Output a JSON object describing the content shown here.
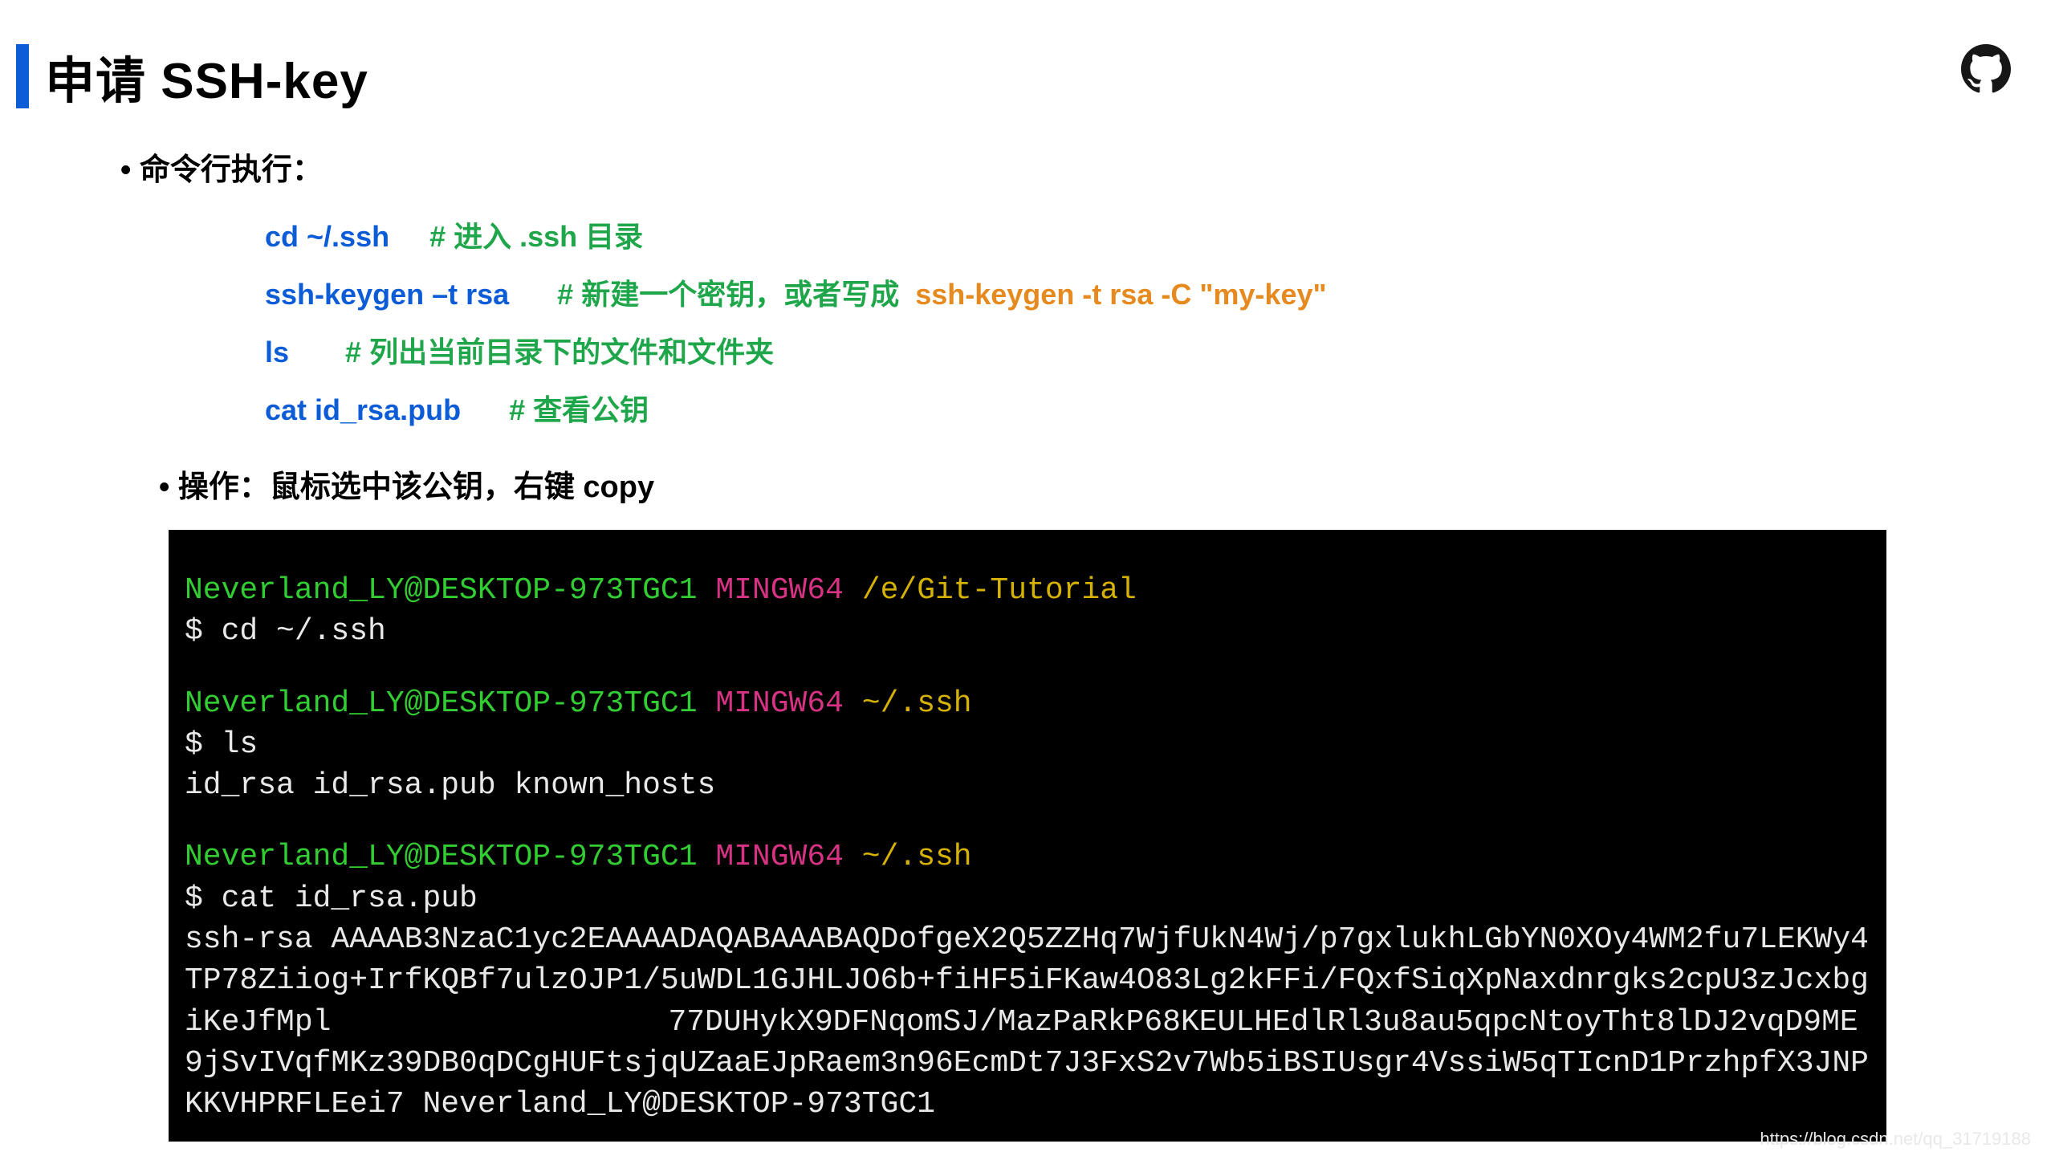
{
  "title": "申请 SSH-key",
  "bullets": {
    "exec": "• 命令行执行：",
    "op": "• 操作：鼠标选中该公钥，右键 copy"
  },
  "cmds": {
    "l1": {
      "cmd": "cd ~/.ssh",
      "cmt": "# 进入 .ssh 目录"
    },
    "l2": {
      "cmd": "ssh-keygen –t rsa",
      "cmt": "# 新建一个密钥，或者写成",
      "alt": "ssh-keygen -t rsa -C \"my-key\""
    },
    "l3": {
      "cmd": "ls",
      "cmt": "# 列出当前目录下的文件和文件夹"
    },
    "l4": {
      "cmd": "cat id_rsa.pub",
      "cmt": "# 查看公钥"
    }
  },
  "term": {
    "p1": {
      "user": "Neverland_LY@DESKTOP-973TGC1",
      "env": "MINGW64",
      "path": "/e/Git-Tutorial"
    },
    "c1": "$ cd ~/.ssh",
    "p2": {
      "user": "Neverland_LY@DESKTOP-973TGC1",
      "env": "MINGW64",
      "path": "~/.ssh"
    },
    "c2": "$ ls",
    "r2": "id_rsa  id_rsa.pub  known_hosts",
    "p3": {
      "user": "Neverland_LY@DESKTOP-973TGC1",
      "env": "MINGW64",
      "path": "~/.ssh"
    },
    "c3": "$ cat id_rsa.pub",
    "key_a": "ssh-rsa AAAAB3NzaC1yc2EAAAADAQABAAABAQDofgeX2Q5ZZHq7WjfUkN4Wj/p7gxlukhLGbYN0XOy4WM2fu7LEKWy4TP78Ziiog+IrfKQBf7ulzOJP1/5uWDL1GJHLJO6b+fiHF5iFKaw4O83Lg2kFFi/FQxfSiqXpNaxdnrgks2cpU3zJcxbgiKeJfMpl",
    "key_b": "77DUHykX9DFNqomSJ/MazPaRkP68KEULHEdlRl3u8au5qpcNtoyTht8lDJ2vqD9ME9jSvIVqfMKz39DB0qDCgHUFtsjqUZaaEJpRaem3n96EcmDt7J3FxS2v7Wb5iBSIUsgr4VssiW5qTIcnD1PrzhpfX3JNPKKVHPRFLEei7 Neverland_LY@DESKTOP-973TGC1"
  },
  "watermark": "https://blog.csdn.net/qq_31719188"
}
